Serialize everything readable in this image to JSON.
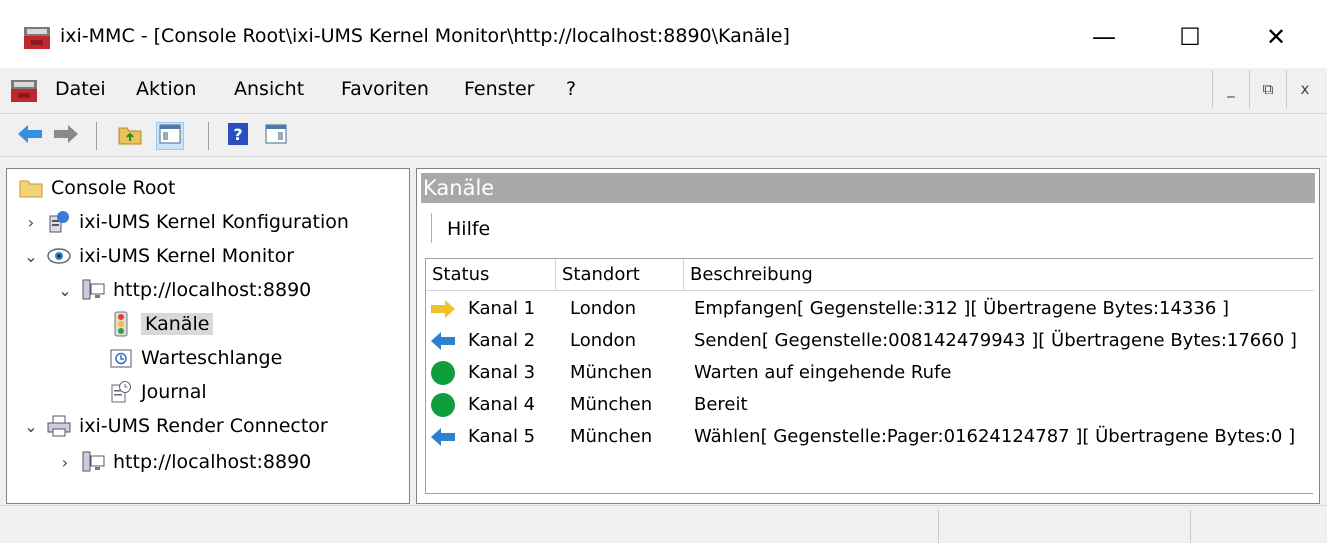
{
  "window": {
    "title": "ixi-MMC - [Console Root\\ixi-UMS Kernel Monitor\\http://localhost:8890\\Kanäle]",
    "minimize": "—",
    "maximize": "☐",
    "close": "✕"
  },
  "menu": {
    "items": [
      {
        "label": "Datei"
      },
      {
        "label": "Aktion"
      },
      {
        "label": "Ansicht"
      },
      {
        "label": "Favoriten"
      },
      {
        "label": "Fenster"
      },
      {
        "label": "?"
      }
    ],
    "mdi_min": "_",
    "mdi_restore": "⧉",
    "mdi_close": "x"
  },
  "toolbar": {
    "icons": [
      "back-arrow-icon",
      "forward-arrow-icon",
      "up-folder-icon",
      "show-hide-tree-icon",
      "help-icon",
      "show-action-pane-icon"
    ]
  },
  "tree": {
    "items": [
      {
        "label": "Console Root",
        "icon": "folder-icon",
        "chevron": ""
      },
      {
        "label": "ixi-UMS Kernel Konfiguration",
        "icon": "config-icon",
        "chevron": "›"
      },
      {
        "label": "ixi-UMS Kernel Monitor",
        "icon": "eye-icon",
        "chevron": "⌄"
      },
      {
        "label": "http://localhost:8890",
        "icon": "server-icon",
        "chevron": "⌄"
      },
      {
        "label": "Kanäle",
        "icon": "traffic-light-icon",
        "chevron": ""
      },
      {
        "label": "Warteschlange",
        "icon": "queue-icon",
        "chevron": ""
      },
      {
        "label": "Journal",
        "icon": "journal-icon",
        "chevron": ""
      },
      {
        "label": "ixi-UMS Render Connector",
        "icon": "printer-icon",
        "chevron": "⌄"
      },
      {
        "label": "http://localhost:8890",
        "icon": "server-icon",
        "chevron": "›"
      }
    ]
  },
  "panel": {
    "title": "Kanäle",
    "action_help": "Hilfe",
    "columns": [
      "Status",
      "Standort",
      "Beschreibung"
    ],
    "rows": [
      {
        "status": "Kanal 1",
        "icon": "arrow-right-yellow-icon",
        "location": "London",
        "description": "Empfangen[ Gegenstelle:312 ][ Übertragene Bytes:14336 ]"
      },
      {
        "status": "Kanal 2",
        "icon": "arrow-left-blue-icon",
        "location": "London",
        "description": "Senden[ Gegenstelle:008142479943 ][ Übertragene Bytes:17660 ]"
      },
      {
        "status": "Kanal 3",
        "icon": "green-circle-icon",
        "location": "München",
        "description": "Warten auf eingehende Rufe"
      },
      {
        "status": "Kanal 4",
        "icon": "green-circle-icon",
        "location": "München",
        "description": "Bereit"
      },
      {
        "status": "Kanal 5",
        "icon": "arrow-left-blue-icon",
        "location": "München",
        "description": "Wählen[ Gegenstelle:Pager:01624124787 ][ Übertragene Bytes:0 ]"
      }
    ]
  },
  "colors": {
    "header_gray": "#a8a8a8",
    "arrow_blue": "#2f7fd3",
    "arrow_yellow": "#f2c12e",
    "status_green": "#109e3c"
  }
}
